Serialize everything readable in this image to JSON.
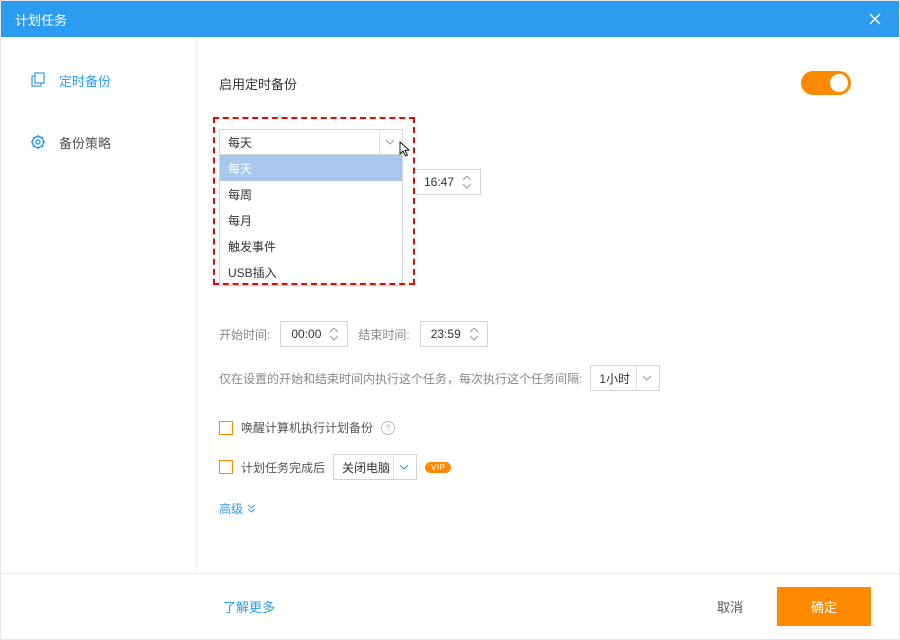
{
  "window": {
    "title": "计划任务"
  },
  "sidebar": {
    "items": [
      {
        "label": "定时备份"
      },
      {
        "label": "备份策略"
      }
    ]
  },
  "main": {
    "enable_label": "启用定时备份",
    "freq_selected": "每天",
    "freq_options": [
      "每天",
      "每周",
      "每月",
      "触发事件",
      "USB插入"
    ],
    "time_value": "16:47",
    "start_label": "开始时间:",
    "start_value": "00:00",
    "end_label": "结束时间:",
    "end_value": "23:59",
    "interval_text": "仅在设置的开始和结束时间内执行这个任务，每次执行这个任务间隔:",
    "interval_value": "1小时",
    "wake_label": "唤醒计算机执行计划备份",
    "after_task_label": "计划任务完成后",
    "after_task_action": "关闭电脑",
    "vip_text": "VIP",
    "advanced": "高级"
  },
  "footer": {
    "learn_more": "了解更多",
    "cancel": "取消",
    "ok": "确定"
  }
}
